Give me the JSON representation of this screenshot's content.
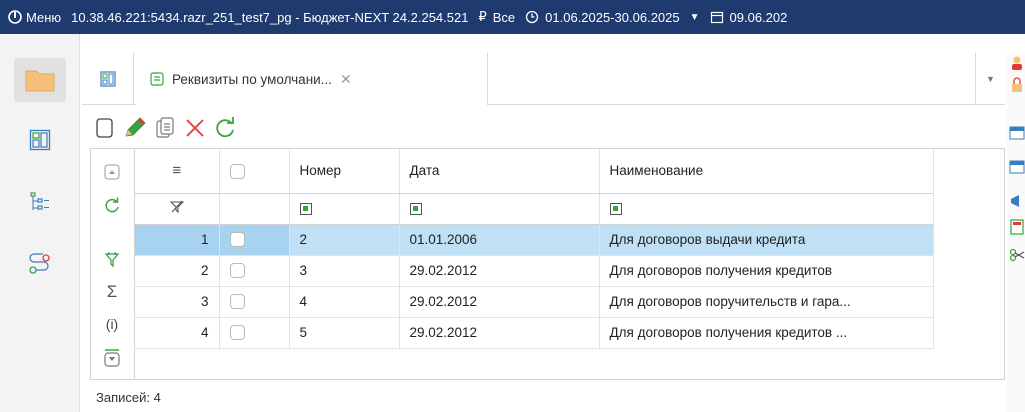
{
  "titlebar": {
    "menu_label": "Меню",
    "connection": "10.38.46.221:5434.razr_251_test7_pg - Бюджет-NEXT 24.2.254.521",
    "currency_label": "Все",
    "period": "01.06.2025-30.06.2025",
    "date": "09.06.202"
  },
  "tabs": {
    "active_label": "Реквизиты по умолчани..."
  },
  "grid": {
    "columns": [
      "Номер",
      "Дата",
      "Наименование"
    ],
    "rows": [
      {
        "n": "1",
        "nomer": "2",
        "data": "01.01.2006",
        "name": "Для договоров выдачи кредита"
      },
      {
        "n": "2",
        "nomer": "3",
        "data": "29.02.2012",
        "name": "Для договоров получения кредитов"
      },
      {
        "n": "3",
        "nomer": "4",
        "data": "29.02.2012",
        "name": "Для договоров поручительств и гара..."
      },
      {
        "n": "4",
        "nomer": "5",
        "data": "29.02.2012",
        "name": "Для договоров получения кредитов ..."
      }
    ],
    "selected_row": 0
  },
  "footer": {
    "records": "Записей: 4"
  },
  "colors": {
    "titlebar_bg": "#1e3a6e",
    "selection": "#bfe0f5",
    "accent_green": "#3aa241",
    "accent_red": "#e53935"
  }
}
